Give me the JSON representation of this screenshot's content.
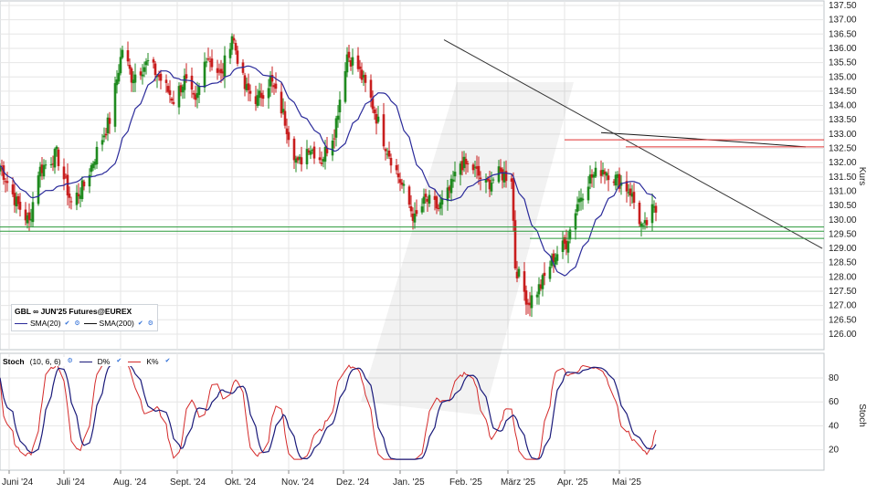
{
  "header": {
    "instrument": "GBL ∞ JUN'25 Futures@EUREX",
    "sma20_label": "SMA(20)",
    "sma200_label": "SMA(200)",
    "ind_title": "Stoch",
    "ind_params": "(10, 6, 6)",
    "d_label": "D%",
    "k_label": "K%"
  },
  "colors": {
    "sma20": "#2a2a9a",
    "sma200": "#1a1a1a",
    "up": "#1f8a1f",
    "down": "#c81e1e",
    "d_line": "#1a1a7a",
    "k_line": "#d42a2a",
    "green_support": "#2a9a3a",
    "red_resistance": "#e03030",
    "grid": "#e6e6e6"
  },
  "chart_data": [
    {
      "type": "candlestick",
      "ylabel": "Kurs",
      "ylim": [
        125.5,
        137.6
      ],
      "yticks": [
        "137.50",
        "137.00",
        "136.50",
        "136.00",
        "135.50",
        "135.00",
        "134.50",
        "134.00",
        "133.50",
        "133.00",
        "132.50",
        "132.00",
        "131.50",
        "131.00",
        "130.50",
        "130.00",
        "129.50",
        "129.00",
        "128.50",
        "128.00",
        "127.50",
        "127.00",
        "126.50",
        "126.00"
      ],
      "xticks": [
        "Juni '24",
        "Juli '24",
        "Aug. '24",
        "Sept. '24",
        "Okt. '24",
        "Nov. '24",
        "Dez. '24",
        "Jan. '25",
        "Feb. '25",
        "März '25",
        "Apr. '25",
        "Mai '25"
      ],
      "close_anchors": [
        [
          "2024-05-27",
          131.9
        ],
        [
          "2024-06-05",
          130.6
        ],
        [
          "2024-06-12",
          129.9
        ],
        [
          "2024-06-17",
          131.7
        ],
        [
          "2024-06-27",
          132.3
        ],
        [
          "2024-07-05",
          130.6
        ],
        [
          "2024-07-12",
          131.2
        ],
        [
          "2024-07-19",
          132.4
        ],
        [
          "2024-07-26",
          133.5
        ],
        [
          "2024-08-02",
          136.0
        ],
        [
          "2024-08-07",
          135.0
        ],
        [
          "2024-08-16",
          135.5
        ],
        [
          "2024-08-22",
          135.0
        ],
        [
          "2024-08-30",
          134.2
        ],
        [
          "2024-09-05",
          134.9
        ],
        [
          "2024-09-11",
          134.0
        ],
        [
          "2024-09-17",
          135.8
        ],
        [
          "2024-09-25",
          135.0
        ],
        [
          "2024-10-01",
          136.5
        ],
        [
          "2024-10-08",
          134.6
        ],
        [
          "2024-10-15",
          134.2
        ],
        [
          "2024-10-22",
          134.9
        ],
        [
          "2024-10-29",
          133.7
        ],
        [
          "2024-11-06",
          131.9
        ],
        [
          "2024-11-12",
          132.6
        ],
        [
          "2024-11-19",
          132.1
        ],
        [
          "2024-11-26",
          133.1
        ],
        [
          "2024-12-03",
          135.8
        ],
        [
          "2024-12-09",
          135.3
        ],
        [
          "2024-12-16",
          134.2
        ],
        [
          "2024-12-23",
          132.8
        ],
        [
          "2025-01-02",
          131.2
        ],
        [
          "2025-01-09",
          130.0
        ],
        [
          "2025-01-15",
          130.7
        ],
        [
          "2025-01-22",
          130.4
        ],
        [
          "2025-01-28",
          131.0
        ],
        [
          "2025-02-03",
          132.0
        ],
        [
          "2025-02-10",
          131.8
        ],
        [
          "2025-02-17",
          131.2
        ],
        [
          "2025-02-24",
          131.6
        ],
        [
          "2025-03-03",
          131.5
        ],
        [
          "2025-03-05",
          128.4
        ],
        [
          "2025-03-12",
          127.1
        ],
        [
          "2025-03-19",
          127.7
        ],
        [
          "2025-03-26",
          128.7
        ],
        [
          "2025-04-02",
          129.2
        ],
        [
          "2025-04-08",
          130.6
        ],
        [
          "2025-04-14",
          131.4
        ],
        [
          "2025-04-22",
          131.8
        ],
        [
          "2025-04-30",
          131.4
        ],
        [
          "2025-05-07",
          131.0
        ],
        [
          "2025-05-14",
          129.6
        ],
        [
          "2025-05-19",
          130.3
        ]
      ],
      "series": [
        {
          "name": "SMA(20)"
        },
        {
          "name": "SMA(200)",
          "values": [
            [
              133.05,
              132.85,
              132.55
            ]
          ]
        }
      ]
    },
    {
      "type": "line",
      "ylabel": "Stoch",
      "ylim": [
        8,
        98
      ],
      "yticks": [
        "80",
        "60",
        "40",
        "20"
      ],
      "series": [
        {
          "name": "D%"
        },
        {
          "name": "K%"
        }
      ]
    }
  ]
}
